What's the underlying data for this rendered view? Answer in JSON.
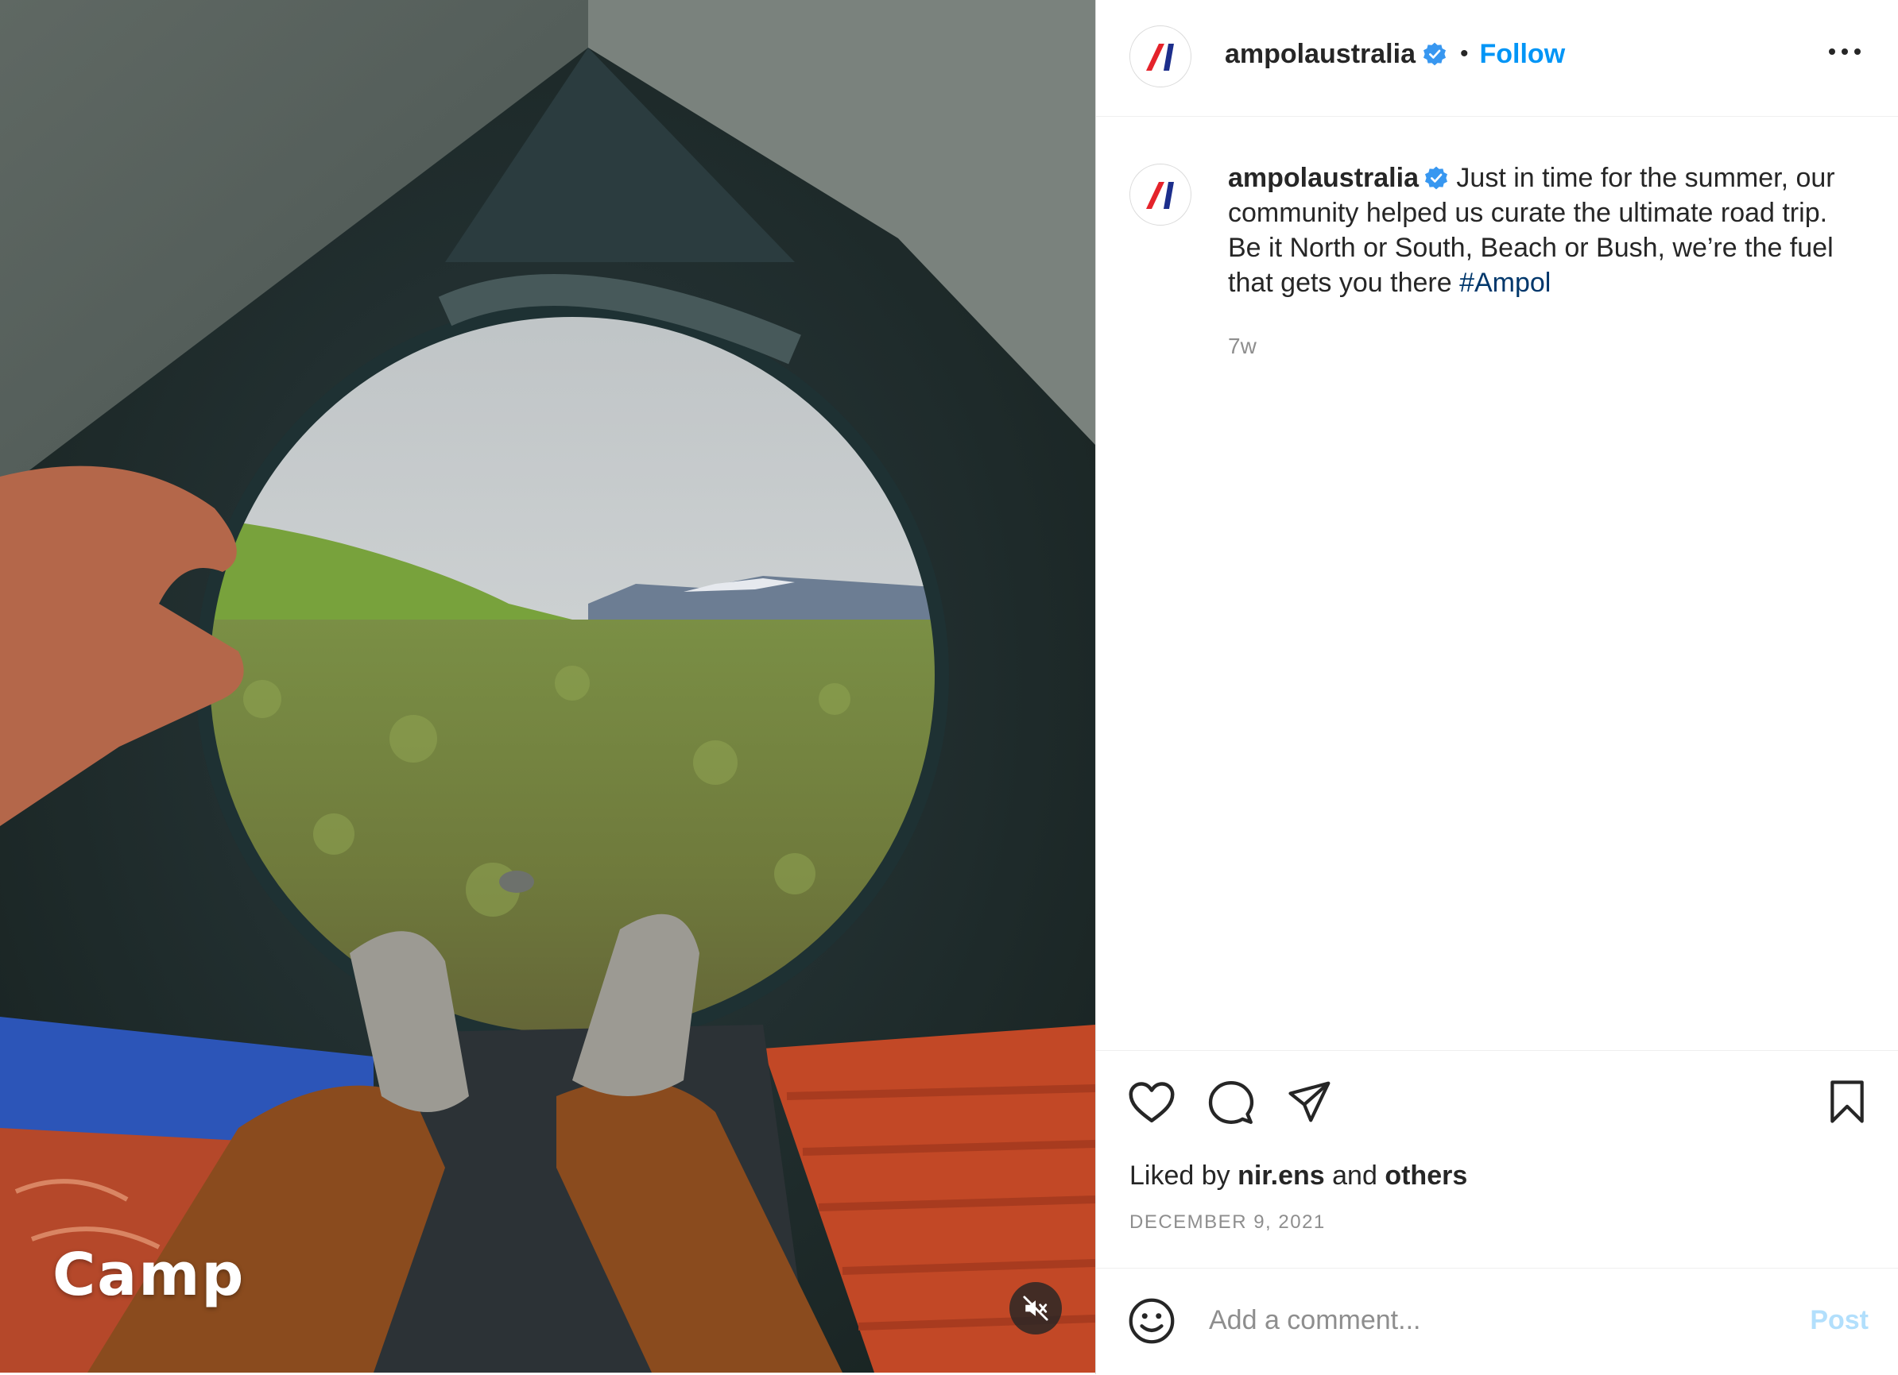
{
  "post": {
    "media": {
      "overlay_text": "Camp",
      "mute_icon": "speaker-muted-icon"
    },
    "header": {
      "username": "ampolaustralia",
      "separator": "•",
      "follow_label": "Follow",
      "more_icon": "more-options-icon"
    },
    "caption": {
      "username": "ampolaustralia",
      "text": " Just in time for the summer, our community helped us curate the ultimate road trip. Be it North or South, Beach or Bush, we’re the fuel that gets you there ",
      "hashtag": "#Ampol",
      "time": "7w"
    },
    "actions": {
      "like_icon": "heart-icon",
      "comment_icon": "comment-icon",
      "share_icon": "paper-plane-icon",
      "save_icon": "bookmark-icon"
    },
    "likes": {
      "prefix": "Liked by ",
      "user": "nir.ens",
      "middle": " and ",
      "suffix": "others"
    },
    "date": "DECEMBER 9, 2021",
    "comment": {
      "placeholder": "Add a comment...",
      "post_label": "Post",
      "emoji_icon": "smiley-icon"
    },
    "colors": {
      "accent_blue": "#0095f6",
      "verified_blue": "#3897f0",
      "hashtag": "#00376b",
      "logo_red": "#e4232b",
      "logo_blue": "#1c2e8c"
    }
  }
}
